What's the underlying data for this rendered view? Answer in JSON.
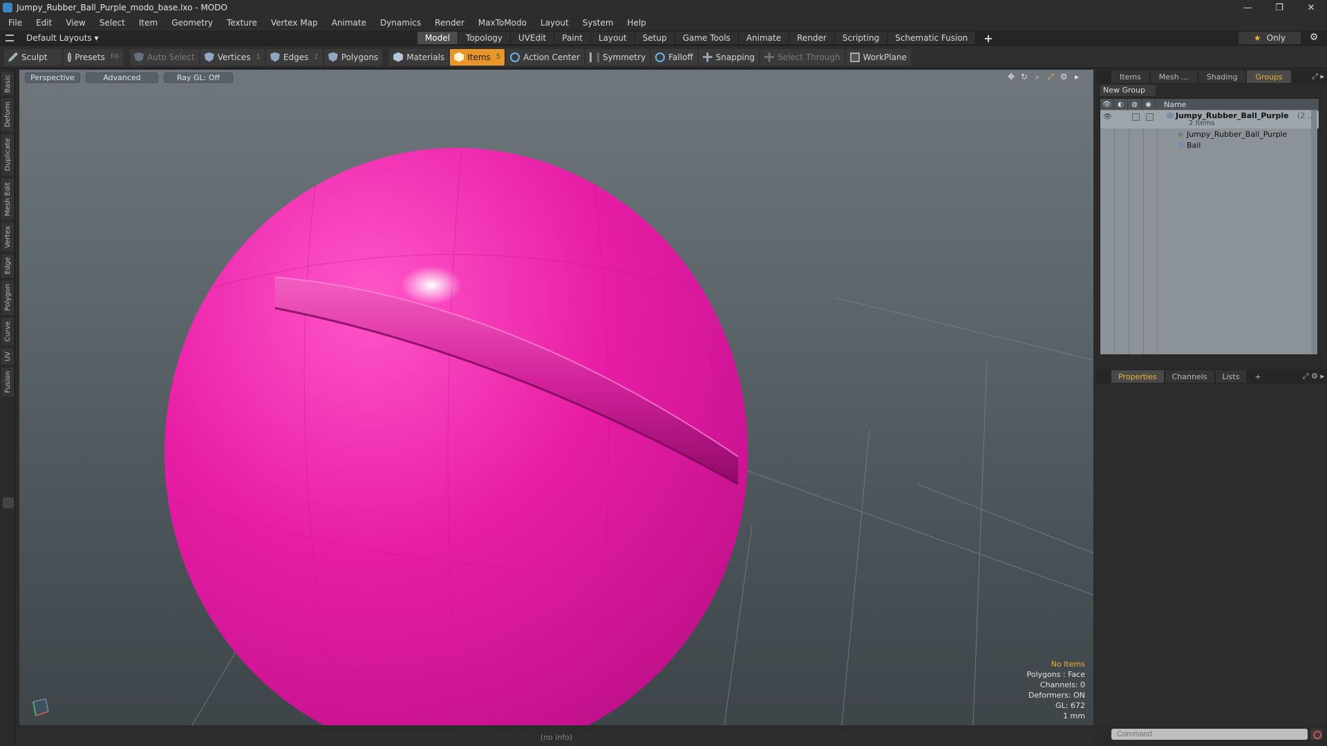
{
  "window": {
    "title": "Jumpy_Rubber_Ball_Purple_modo_base.lxo - MODO",
    "controls": [
      "—",
      "❐",
      "✕"
    ]
  },
  "menu": [
    "File",
    "Edit",
    "View",
    "Select",
    "Item",
    "Geometry",
    "Texture",
    "Vertex Map",
    "Animate",
    "Dynamics",
    "Render",
    "MaxToModo",
    "Layout",
    "System",
    "Help"
  ],
  "layout": {
    "selector": "Default Layouts ▾",
    "tabs": [
      "Model",
      "Topology",
      "UVEdit",
      "Paint",
      "Layout",
      "Setup",
      "Game Tools",
      "Animate",
      "Render",
      "Scripting",
      "Schematic Fusion"
    ],
    "active_tab": "Model",
    "add_tab": "+",
    "only": "Only"
  },
  "toolbar": {
    "sculpt": "Sculpt",
    "presets": "Presets",
    "presets_key": "F6",
    "auto_select": "Auto Select",
    "vertices": "Vertices",
    "vertices_key": "1",
    "edges": "Edges",
    "edges_key": "2",
    "polygons": "Polygons",
    "materials": "Materials",
    "items": "Items",
    "items_key": "5",
    "action_center": "Action Center",
    "symmetry": "Symmetry",
    "falloff": "Falloff",
    "snapping": "Snapping",
    "select_through": "Select Through",
    "workplane": "WorkPlane"
  },
  "left_tabs": [
    "Basic",
    "Deform",
    "Duplicate",
    "Mesh Edit",
    "Vertex",
    "Edge",
    "Polygon",
    "Curve",
    "UV",
    "Fusion"
  ],
  "viewport": {
    "view": "Perspective",
    "shading": "Advanced",
    "raygl": "Ray GL: Off",
    "ball_color": "#e6109e",
    "info": {
      "selection": "No Items",
      "polygons": "Polygons : Face",
      "channels": "Channels: 0",
      "deformers": "Deformers: ON",
      "gl": "GL: 672",
      "scale": "1 mm"
    },
    "status": "(no info)"
  },
  "right_panel": {
    "tabs": [
      "Items",
      "Mesh ...",
      "Shading",
      "Groups"
    ],
    "active_tab": "Groups",
    "new_group": "New Group",
    "column_name": "Name",
    "group": {
      "name": "Jumpy_Rubber_Ball_Purple",
      "suffix": "(2 ...",
      "count": "2 Items",
      "children": [
        "Jumpy_Rubber_Ball_Purple",
        "Ball"
      ]
    },
    "bottom_tabs": [
      "Properties",
      "Channels",
      "Lists",
      "+"
    ],
    "bottom_active": "Properties",
    "command_placeholder": "Command"
  }
}
